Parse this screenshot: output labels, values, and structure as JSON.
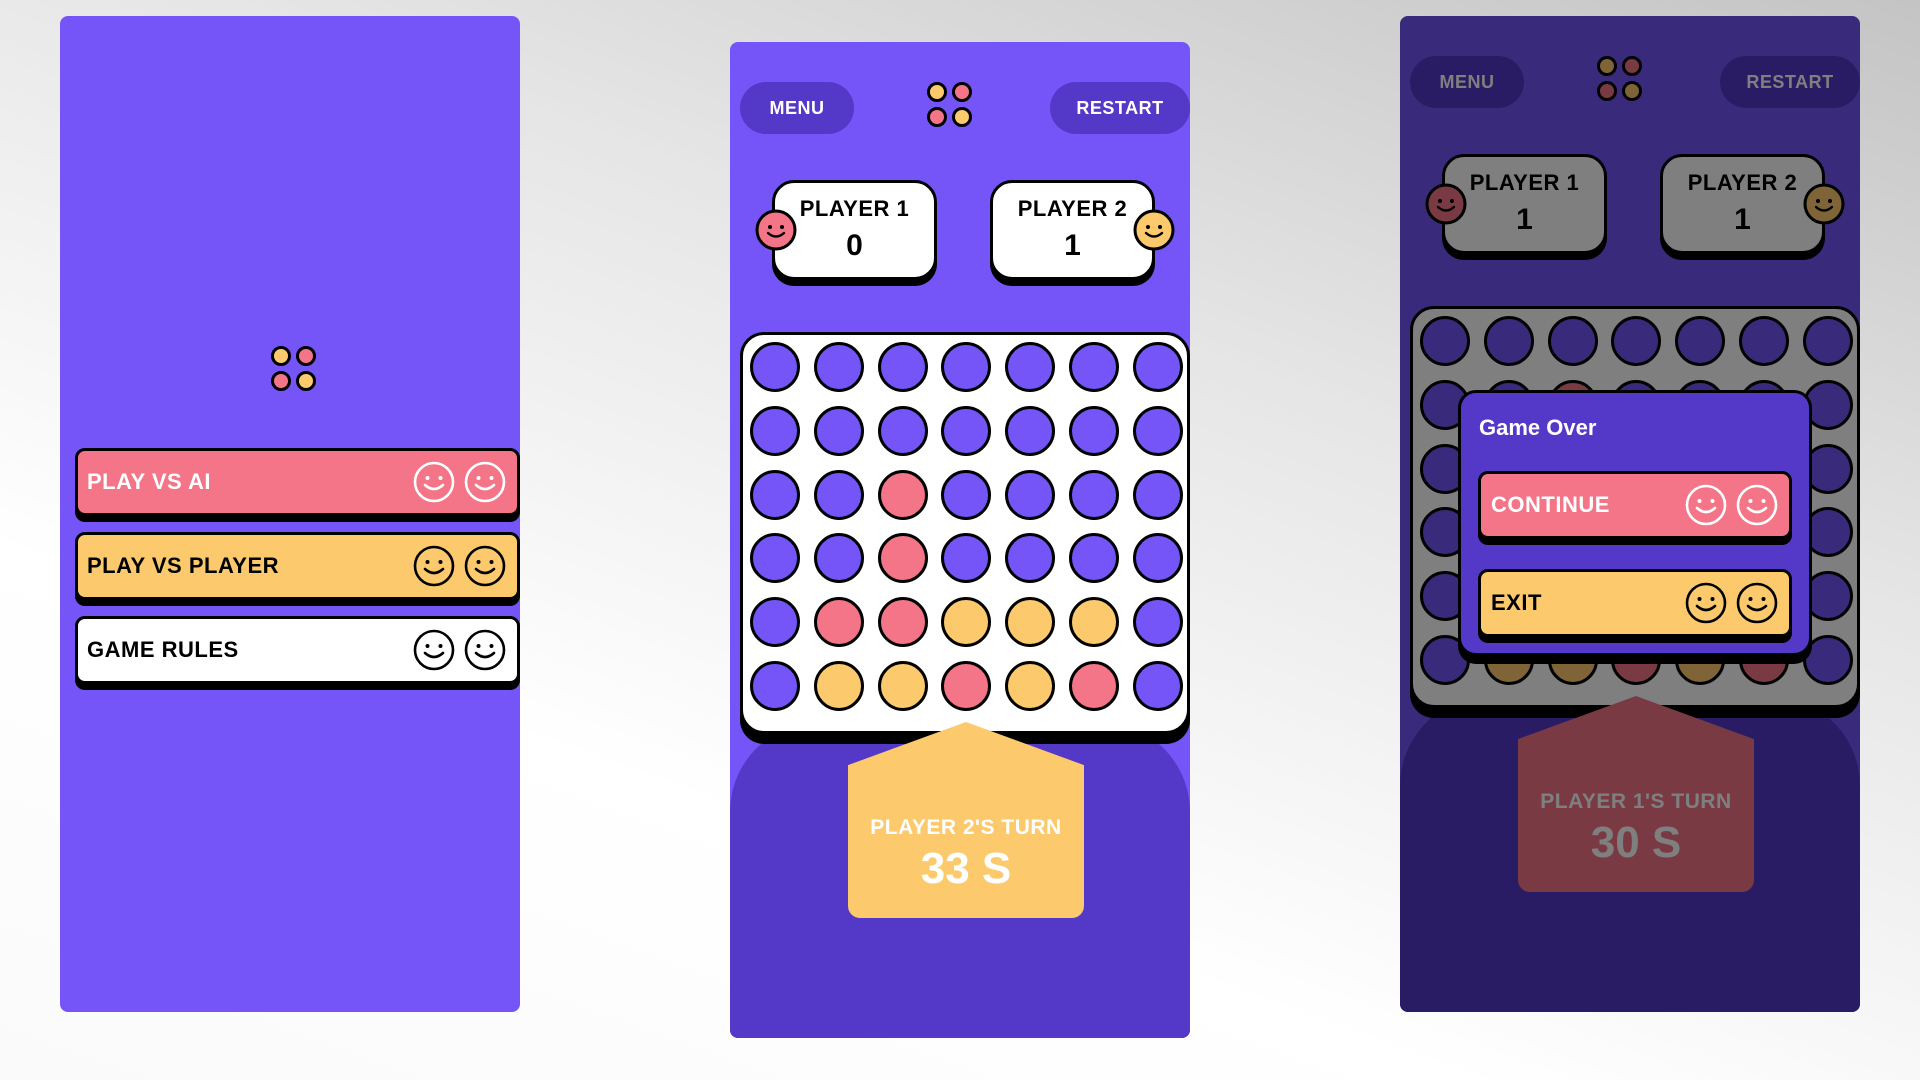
{
  "colors": {
    "purple": "#7555f8",
    "dark_purple": "#5438c8",
    "pink": "#f47587",
    "yellow": "#fcc96d",
    "white": "#ffffff",
    "black": "#000000"
  },
  "menu_screen": {
    "buttons": [
      {
        "label": "PLAY VS AI",
        "color": "pink",
        "icon": "smiley-face-icon"
      },
      {
        "label": "PLAY VS PLAYER",
        "color": "yellow",
        "icon": "smiley-face-icon"
      },
      {
        "label": "GAME RULES",
        "color": "white",
        "icon": "smiley-face-icon"
      }
    ]
  },
  "game_screen": {
    "menu_label": "MENU",
    "restart_label": "RESTART",
    "player1": {
      "name": "PLAYER 1",
      "score": "0"
    },
    "player2": {
      "name": "PLAYER 2",
      "score": "1"
    },
    "board": [
      [
        "E",
        "E",
        "E",
        "E",
        "E",
        "E",
        "E"
      ],
      [
        "E",
        "E",
        "E",
        "E",
        "E",
        "E",
        "E"
      ],
      [
        "E",
        "E",
        "R",
        "E",
        "E",
        "E",
        "E"
      ],
      [
        "E",
        "E",
        "R",
        "E",
        "E",
        "E",
        "E"
      ],
      [
        "E",
        "R",
        "R",
        "Y",
        "Y",
        "Y",
        "E"
      ],
      [
        "E",
        "Y",
        "Y",
        "R",
        "Y",
        "R",
        "E"
      ]
    ],
    "turn_label": "PLAYER 2'S TURN",
    "timer": "33 S"
  },
  "gameover_screen": {
    "menu_label": "MENU",
    "restart_label": "RESTART",
    "player1": {
      "name": "PLAYER 1",
      "score": "1"
    },
    "player2": {
      "name": "PLAYER 2",
      "score": "1"
    },
    "board": [
      [
        "E",
        "E",
        "E",
        "E",
        "E",
        "E",
        "E"
      ],
      [
        "E",
        "E",
        "R",
        "E",
        "E",
        "E",
        "E"
      ],
      [
        "E",
        "E",
        "E",
        "E",
        "E",
        "E",
        "E"
      ],
      [
        "E",
        "E",
        "E",
        "E",
        "E",
        "E",
        "E"
      ],
      [
        "E",
        "E",
        "E",
        "E",
        "E",
        "E",
        "E"
      ],
      [
        "E",
        "Y",
        "Y",
        "R",
        "Y",
        "R",
        "E"
      ]
    ],
    "turn_label": "PLAYER 1'S TURN",
    "timer": "30 S",
    "modal": {
      "title": "Game Over",
      "continue_label": "CONTINUE",
      "exit_label": "EXIT"
    }
  }
}
